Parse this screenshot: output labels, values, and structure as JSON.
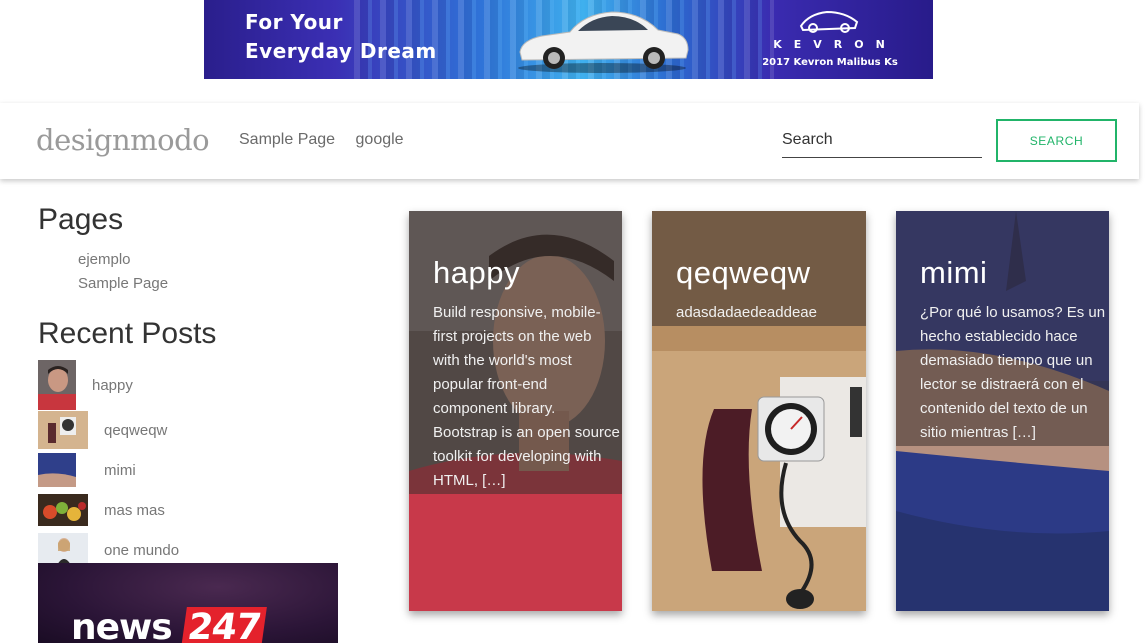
{
  "banner": {
    "slogan_line1": "For Your",
    "slogan_line2": "Everyday Dream",
    "brand": "KEVRON",
    "model": "2017 Kevron Malibus Ks"
  },
  "header": {
    "logo": "designmodo",
    "nav": [
      "Sample Page",
      "google"
    ],
    "search_placeholder": "Search",
    "search_button": "SEARCH"
  },
  "sidebar": {
    "pages_title": "Pages",
    "pages": [
      "ejemplo",
      "Sample Page"
    ],
    "recent_title": "Recent Posts",
    "recent": [
      "happy",
      "qeqweqw",
      "mimi",
      "mas mas",
      "one mundo"
    ]
  },
  "ad": {
    "word": "news",
    "number": "247"
  },
  "posts": [
    {
      "title": "happy",
      "excerpt": "Build responsive, mobile-first projects on the web with the world's most popular front-end component library. Bootstrap is an open source toolkit for developing with HTML, […]"
    },
    {
      "title": "qeqweqw",
      "excerpt": "adasdadaedeaddeae"
    },
    {
      "title": "mimi",
      "excerpt": "¿Por qué lo usamos? Es un hecho establecido hace demasiado tiempo que un lector se distraerá con el contenido del texto de un sitio mientras […]"
    }
  ],
  "colors": {
    "accent": "#21b469",
    "banner": "#3b2fb4"
  }
}
